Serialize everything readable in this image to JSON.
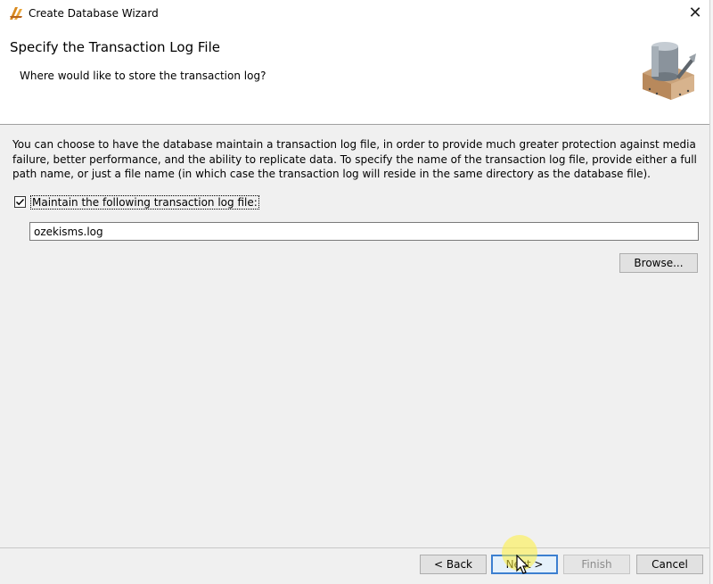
{
  "window": {
    "title": "Create Database Wizard",
    "close_glyph": "✕"
  },
  "header": {
    "title": "Specify the Transaction Log File",
    "subtitle": "Where would like to store the transaction log?",
    "icon": "database-icon"
  },
  "content": {
    "description": "You can choose to have the database maintain a transaction log file, in order to provide much greater protection against media failure, better performance, and the ability to replicate data. To specify the name of the transaction log file, provide either a full path name, or just a file name (in which case the transaction log will reside in the same directory as the database file).",
    "maintain_log": {
      "label": "Maintain the following transaction log file:",
      "checked": true
    },
    "log_file_value": "ozekisms.log",
    "browse_label": "Browse..."
  },
  "footer": {
    "back_label": "< Back",
    "next_label": "Next >",
    "finish_label": "Finish",
    "cancel_label": "Cancel"
  },
  "colors": {
    "content_bg": "#f0f0f0",
    "button_bg": "#e1e1e1",
    "focus_border": "#3c7fd0"
  }
}
